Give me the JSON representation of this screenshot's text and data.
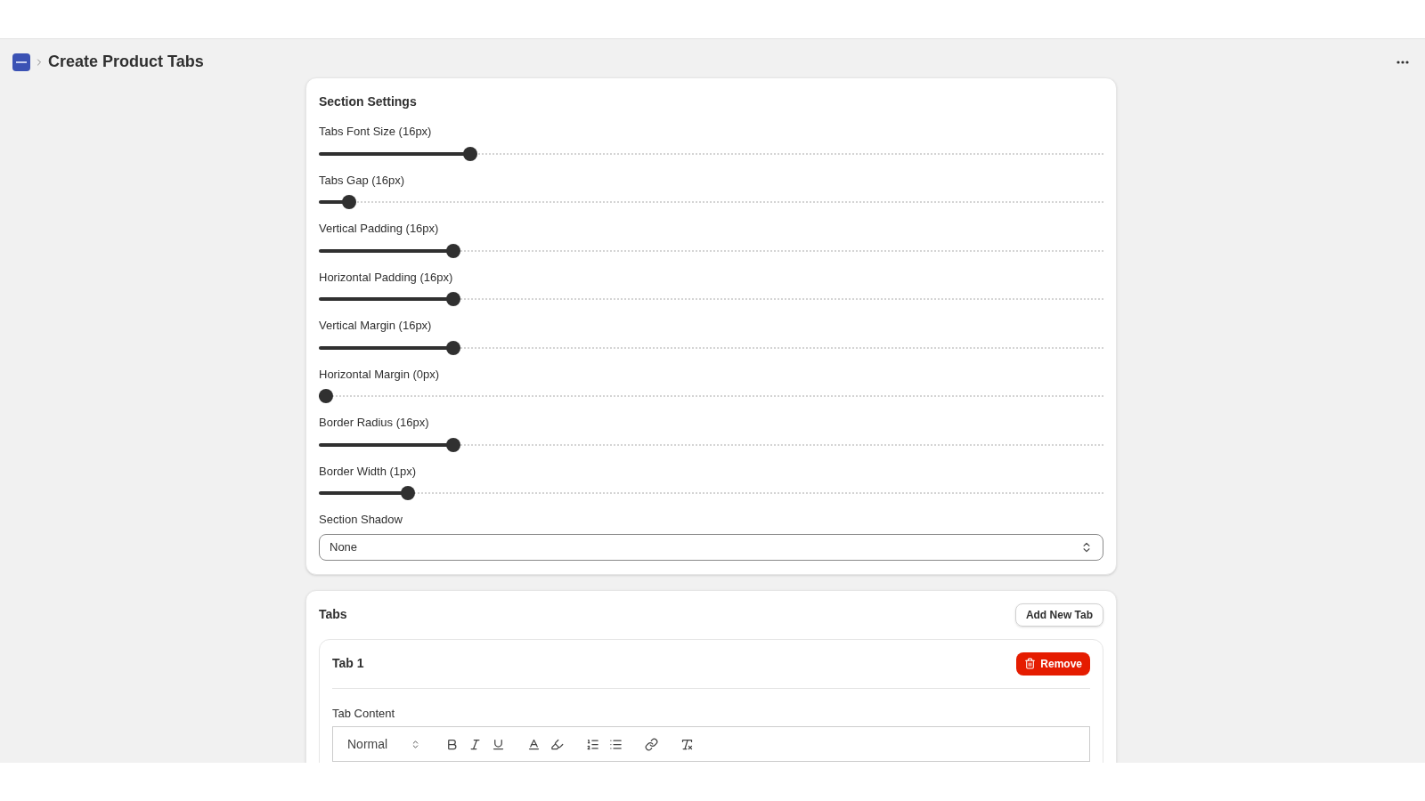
{
  "header": {
    "title": "Create Product Tabs"
  },
  "section_settings": {
    "title": "Section Settings",
    "sliders": [
      {
        "label": "Tabs Font Size (16px)",
        "level": 0.187
      },
      {
        "label": "Tabs Gap (16px)",
        "level": 0.03
      },
      {
        "label": "Vertical Padding (16px)",
        "level": 0.165
      },
      {
        "label": "Horizontal Padding (16px)",
        "level": 0.165
      },
      {
        "label": "Vertical Margin (16px)",
        "level": 0.165
      },
      {
        "label": "Horizontal Margin (0px)",
        "level": 0
      },
      {
        "label": "Border Radius (16px)",
        "level": 0.165
      },
      {
        "label": "Border Width (1px)",
        "level": 0.106
      }
    ],
    "shadow": {
      "label": "Section Shadow",
      "value": "None"
    }
  },
  "tabs_section": {
    "title": "Tabs",
    "add_button": "Add New Tab",
    "tabs": [
      {
        "title": "Tab 1",
        "remove_button": "Remove",
        "content_label": "Tab Content",
        "format_select": "Normal"
      }
    ]
  }
}
